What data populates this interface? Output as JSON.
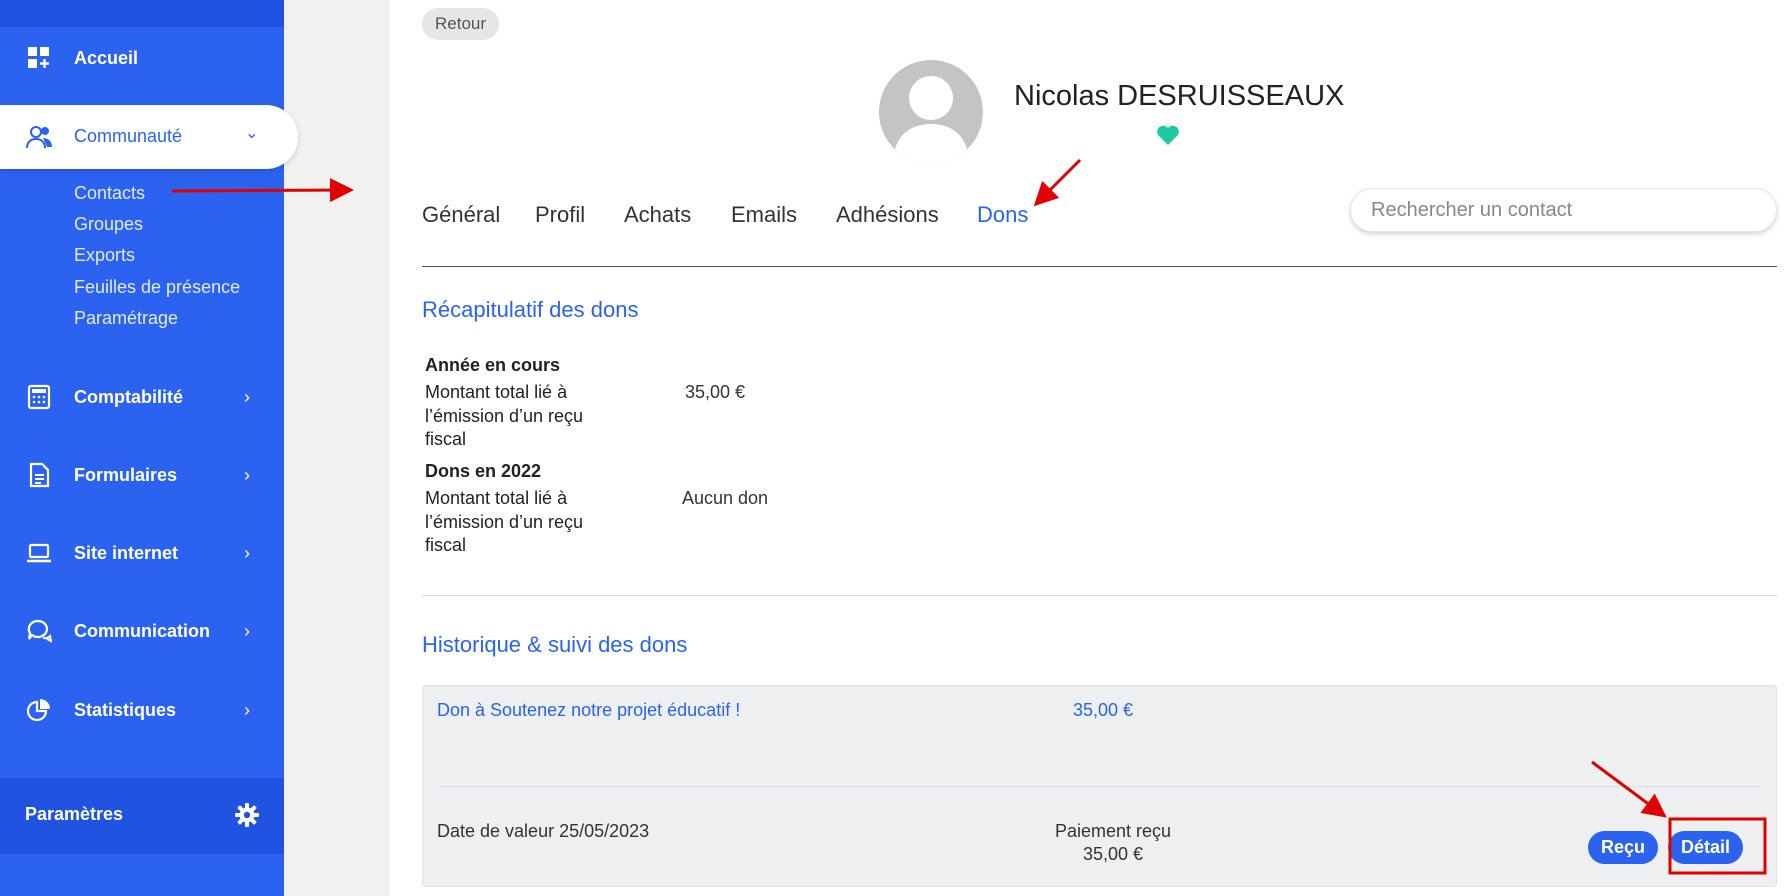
{
  "sidebar": {
    "items": [
      {
        "label": "Accueil",
        "icon": "dashboard-icon"
      },
      {
        "label": "Communauté",
        "icon": "community-icon"
      },
      {
        "label": "Comptabilité",
        "icon": "calculator-icon"
      },
      {
        "label": "Formulaires",
        "icon": "document-icon"
      },
      {
        "label": "Site internet",
        "icon": "laptop-icon"
      },
      {
        "label": "Communication",
        "icon": "chat-icon"
      },
      {
        "label": "Statistiques",
        "icon": "pie-chart-icon"
      }
    ],
    "sub_items": [
      "Contacts",
      "Groupes",
      "Exports",
      "Feuilles de présence",
      "Paramétrage"
    ],
    "settings_label": "Paramètres",
    "chevron": "›",
    "chevron_down": "⌄"
  },
  "header": {
    "back_label": "Retour",
    "contact_name": "Nicolas DESRUISSEAUX"
  },
  "tabs": [
    "Général",
    "Profil",
    "Achats",
    "Emails",
    "Adhésions",
    "Dons"
  ],
  "active_tab": "Dons",
  "search": {
    "placeholder": "Rechercher un contact"
  },
  "recap": {
    "title": "Récapitulatif des dons",
    "current_year_heading": "Année en cours",
    "current_label_line1": "Montant total lié à",
    "current_label_line2": "l’émission d’un reçu",
    "current_label_line3": "fiscal",
    "current_value": "35,00 €",
    "year_2022_heading": "Dons en 2022",
    "y2022_label_line1": "Montant total lié à",
    "y2022_label_line2": "l’émission d’un reçu",
    "y2022_label_line3": "fiscal",
    "y2022_value": "Aucun don"
  },
  "history": {
    "title": "Historique & suivi des dons",
    "donation_title": "Don à Soutenez notre projet éducatif !",
    "donation_amount": "35,00 €",
    "date_label": "Date de valeur 25/05/2023",
    "payment_status": "Paiement reçu",
    "payment_amount": "35,00 €",
    "receipt_button": "Reçu",
    "detail_button": "Détail"
  },
  "colors": {
    "brand_blue": "#2b63f0",
    "annotation_red": "#e00000",
    "heart_teal": "#1dc9a4"
  }
}
